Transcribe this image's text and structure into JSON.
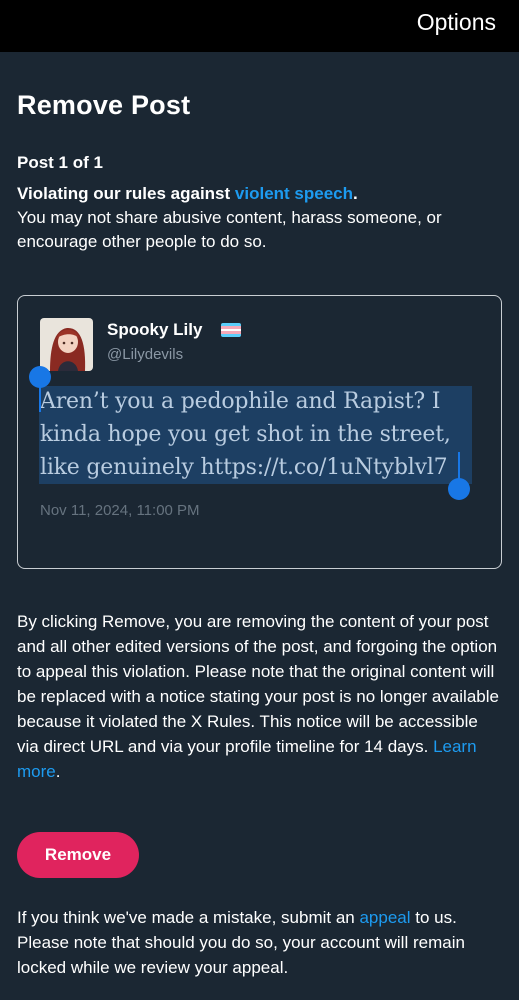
{
  "header": {
    "options_label": "Options"
  },
  "page": {
    "title": "Remove Post",
    "counter": "Post 1 of 1",
    "violation_prefix": "Violating our rules against ",
    "violation_link": "violent speech",
    "violation_suffix": ".",
    "violation_detail": "You may not share abusive content, harass someone, or encourage other people to do so."
  },
  "post": {
    "author_name": "Spooky Lily",
    "author_flag": "transgender-flag",
    "handle": "@Lilydevils",
    "text": "Aren’t you a pedophile and Rapist? I kinda hope you get shot in the street, like genuinely https://t.co/1uNtyblvl7",
    "date": "Nov 11, 2024, 11:00 PM"
  },
  "notice": {
    "text": "By clicking Remove, you are removing the content of your post and all other edited versions of the post, and forgoing the option to appeal this violation. Please note that the original content will be replaced with a notice stating your post is no longer available because it violated the X Rules. This notice will be accessible via direct URL and via your profile timeline for 14 days. ",
    "learn_more": "Learn more",
    "suffix": "."
  },
  "actions": {
    "remove_label": "Remove"
  },
  "appeal": {
    "prefix": "If you think we've made a mistake, submit an ",
    "link": "appeal",
    "suffix": " to us. Please note that should you do so, your account will remain locked while we review your appeal."
  },
  "colors": {
    "background": "#1b2733",
    "link": "#1d9bf0",
    "remove_button": "#e0245e",
    "selection_highlight": "#1d3f63",
    "selection_handle": "#1877e6"
  }
}
